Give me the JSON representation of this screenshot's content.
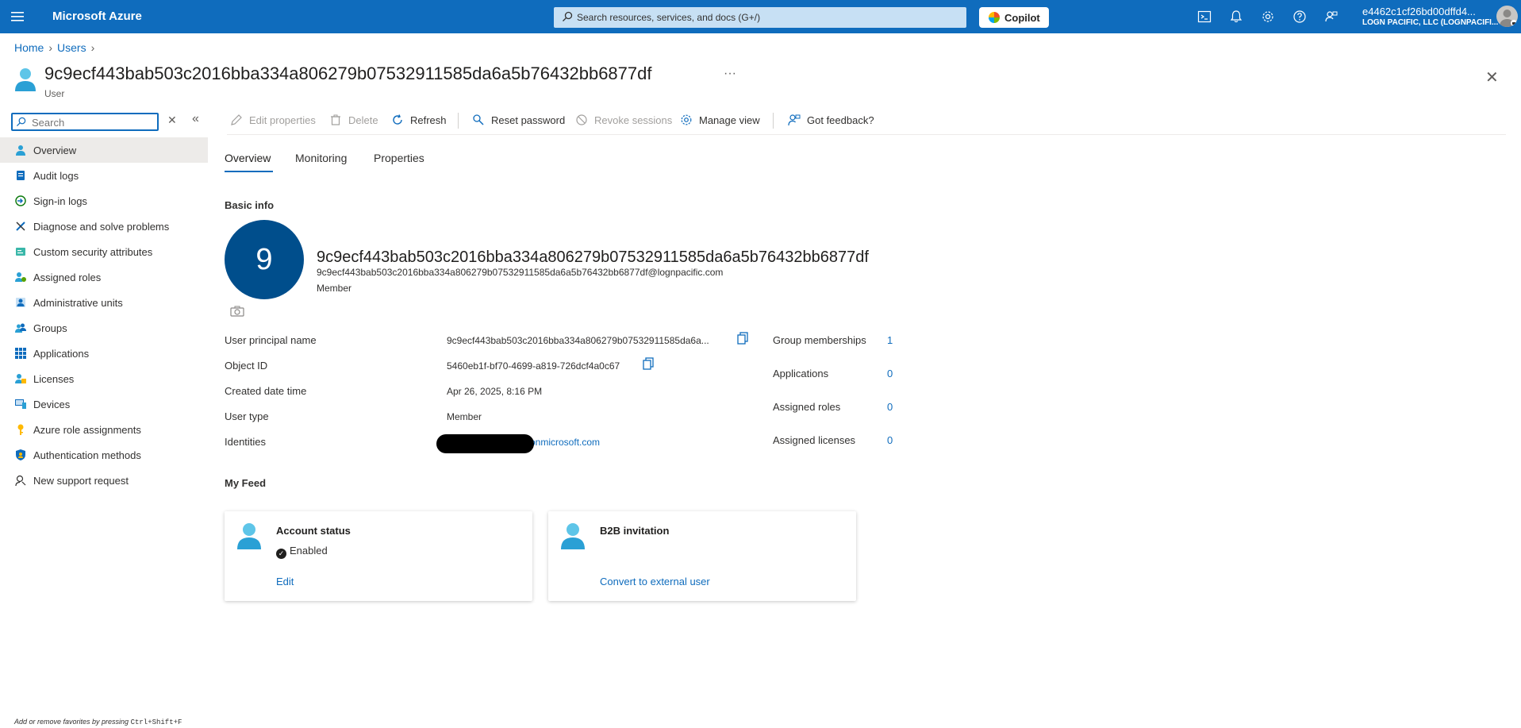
{
  "topbar": {
    "brand": "Microsoft Azure",
    "search_placeholder": "Search resources, services, and docs (G+/)",
    "copilot_label": "Copilot",
    "account_name": "e4462c1cf26bd00dffd4...",
    "account_tenant": "LOGN PACIFIC, LLC (LOGNPACIFI..."
  },
  "breadcrumb": {
    "home": "Home",
    "users": "Users"
  },
  "header": {
    "title": "9c9ecf443bab503c2016bba334a806279b07532911585da6a5b76432bb6877df",
    "subtitle": "User",
    "more": "···"
  },
  "sidebar": {
    "search_placeholder": "Search",
    "items": [
      {
        "label": "Overview",
        "icon": "user-icon",
        "active": true
      },
      {
        "label": "Audit logs",
        "icon": "audit-log-icon"
      },
      {
        "label": "Sign-in logs",
        "icon": "sign-in-icon"
      },
      {
        "label": "Diagnose and solve problems",
        "icon": "wrench-icon"
      },
      {
        "label": "Custom security attributes",
        "icon": "attributes-icon"
      },
      {
        "label": "Assigned roles",
        "icon": "roles-icon"
      },
      {
        "label": "Administrative units",
        "icon": "admin-units-icon"
      },
      {
        "label": "Groups",
        "icon": "groups-icon"
      },
      {
        "label": "Applications",
        "icon": "apps-grid-icon"
      },
      {
        "label": "Licenses",
        "icon": "license-icon"
      },
      {
        "label": "Devices",
        "icon": "device-icon"
      },
      {
        "label": "Azure role assignments",
        "icon": "key-icon"
      },
      {
        "label": "Authentication methods",
        "icon": "shield-icon"
      },
      {
        "label": "New support request",
        "icon": "support-icon"
      }
    ],
    "favorites_hint": "Add or remove favorites by pressing",
    "favorites_keys": "Ctrl+Shift+F"
  },
  "commands": {
    "edit": "Edit properties",
    "delete": "Delete",
    "refresh": "Refresh",
    "reset_password": "Reset password",
    "revoke": "Revoke sessions",
    "manage_view": "Manage view",
    "feedback": "Got feedback?"
  },
  "tabs": {
    "overview": "Overview",
    "monitoring": "Monitoring",
    "properties": "Properties"
  },
  "basic_info": {
    "heading": "Basic info",
    "initial": "9",
    "display_name": "9c9ecf443bab503c2016bba334a806279b07532911585da6a5b76432bb6877df",
    "email": "9c9ecf443bab503c2016bba334a806279b07532911585da6a5b76432bb6877df@lognpacific.com",
    "user_type": "Member"
  },
  "properties": {
    "upn_label": "User principal name",
    "upn_value": "9c9ecf443bab503c2016bba334a806279b07532911585da6a...",
    "object_id_label": "Object ID",
    "object_id_value": "5460eb1f-bf70-4699-a819-726dcf4a0c67",
    "created_label": "Created date time",
    "created_value": "Apr 26, 2025, 8:16 PM",
    "user_type_label": "User type",
    "user_type_value": "Member",
    "identities_label": "Identities",
    "identities_value": "onmicrosoft.com"
  },
  "stats": {
    "group_label": "Group memberships",
    "group_value": "1",
    "apps_label": "Applications",
    "apps_value": "0",
    "roles_label": "Assigned roles",
    "roles_value": "0",
    "licenses_label": "Assigned licenses",
    "licenses_value": "0"
  },
  "feed": {
    "heading": "My Feed",
    "account_title": "Account status",
    "account_status": "Enabled",
    "account_link": "Edit",
    "b2b_title": "B2B invitation",
    "b2b_link": "Convert to external user"
  },
  "colors": {
    "accent": "#0f6cbd",
    "avatar_bg": "#004e8c",
    "topbar": "#0f6cbd"
  }
}
